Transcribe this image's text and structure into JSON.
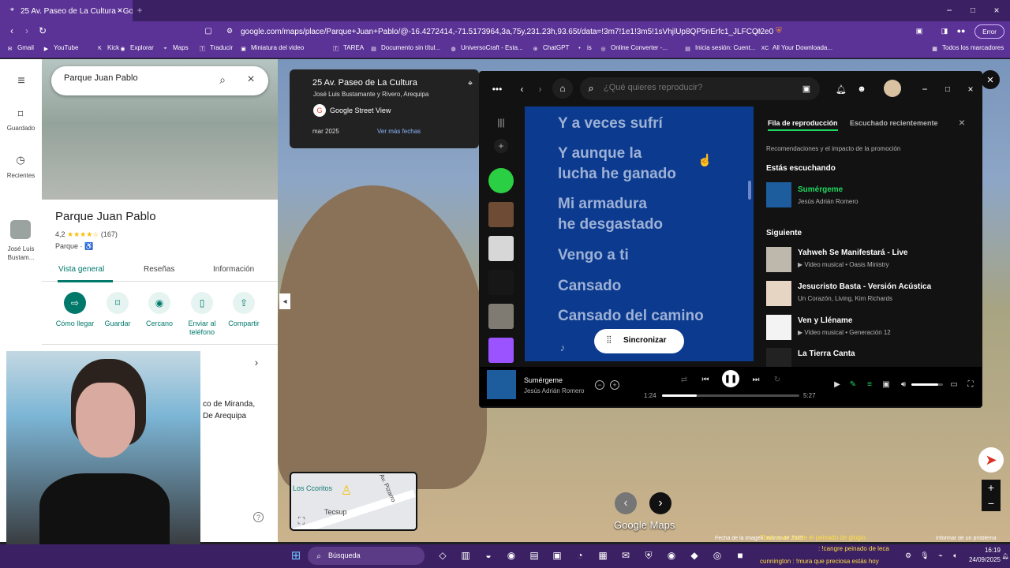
{
  "browser": {
    "tab_title": "25 Av. Paseo de La Cultura - Go",
    "url": "google.com/maps/place/Parque+Juan+Pablo/@-16.4272414,-71.5173964,3a,75y,231.23h,93.65t/data=!3m7!1e1!3m5!1sVhjlUp8QP5nErfc1_JLFCQ!2e0!6sht...",
    "error_label": "Error",
    "bookmarks": [
      "Gmail",
      "YouTube",
      "Kick",
      "Explorar",
      "Maps",
      "Traducir",
      "Miniatura del video",
      "TAREA",
      "Documento sin títul...",
      "UniversoCraft - Esta...",
      "ChatGPT",
      "is",
      "Online Converter -...",
      "Inicia sesión: Cuent...",
      "All Your Downloada...",
      "Todos los marcadores"
    ]
  },
  "maps_ui": {
    "search_value": "Parque Juan Pablo",
    "place_name": "Parque Juan Pablo",
    "rating": "4,2",
    "stars": "★★★★☆",
    "reviews": "(167)",
    "category": "Parque · ♿",
    "tabs": [
      "Vista general",
      "Reseñas",
      "Información"
    ],
    "actions": [
      "Cómo llegar",
      "Guardar",
      "Cercano",
      "Enviar al teléfono",
      "Compartir"
    ],
    "partial_text": "co de Miranda,\nDe Arequipa",
    "left_nav": [
      "Guardado",
      "Recientes",
      "José Luis Bustam..."
    ]
  },
  "streetview": {
    "address": "25 Av. Paseo de La Cultura",
    "subtitle": "José Luis Bustamante y Rivero, Arequipa",
    "source": "Google Street View",
    "date": "mar 2025",
    "more_dates": "Ver más fechas",
    "minimap_labels": [
      "Los Ccoritos",
      "Av. Pizarro",
      "Tecsup"
    ],
    "google_maps_logo": "Google Maps",
    "footer": "Fecha de la imagen: marzo de 2025",
    "report": "Informar de un problema"
  },
  "spotify": {
    "search_placeholder": "¿Qué quieres reproducir?",
    "lyrics": [
      "Y a veces sufrí",
      "Y aunque la\nlucha he ganado",
      "Mi armadura\nhe desgastado",
      "Vengo a ti",
      "Cansado",
      "Cansado del camino"
    ],
    "sync_button": "Sincronizar",
    "queue_tab_active": "Fila de reproducción",
    "queue_tab": "Escuchado recientemente",
    "queue_note": "Recomendaciones y el impacto de la promoción",
    "now_playing_heading": "Estás escuchando",
    "now_playing": {
      "title": "Sumérgeme",
      "artist": "Jesús Adrián Romero"
    },
    "next_heading": "Siguiente",
    "next_items": [
      {
        "title": "Yahweh Se Manifestará - Live",
        "sub": "▶ Video musical • Oasis Ministry"
      },
      {
        "title": "Jesucristo Basta - Versión Acústica",
        "sub": "Un Corazón, Living, Kim Richards"
      },
      {
        "title": "Ven y Lléname",
        "sub": "▶ Video musical • Generación 12"
      },
      {
        "title": "La Tierra Canta",
        "sub": ""
      }
    ],
    "player": {
      "title": "Sumérgeme",
      "artist": "Jesús Adrián Romero",
      "elapsed": "1:24",
      "duration": "5:27",
      "progress": 0.25,
      "volume": 0.85
    }
  },
  "chat": {
    "lines": [
      "Tbob a ver hazte el peinado de glogio",
      ": !cangre peinado de leca",
      "cunnington : !mura que preciosa estás hoy"
    ]
  },
  "taskbar": {
    "search": "Búsqueda",
    "time": "16:19",
    "date": "24/09/2025"
  }
}
